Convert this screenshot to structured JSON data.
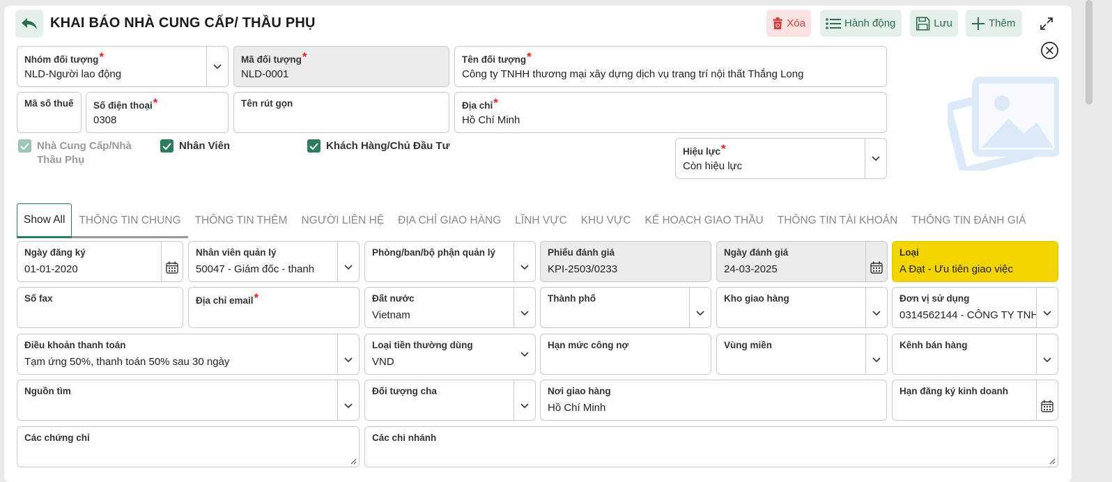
{
  "header": {
    "title": "KHAI BÁO NHÀ CUNG CẤP/ THẦU PHỤ",
    "delete_label": "Xóa",
    "actions_label": "Hành động",
    "save_label": "Lưu",
    "add_label": "Thêm"
  },
  "top": {
    "nhom_doi_tuong": {
      "label": "Nhóm đối tượng",
      "value": "NLD-Người lao động"
    },
    "ma_doi_tuong": {
      "label": "Mã đối tượng",
      "value": "NLD-0001"
    },
    "ten_doi_tuong": {
      "label": "Tên đối tượng",
      "value": "Công ty TNHH thương mại xây dựng dịch vụ trang trí nội thất Thắng Long"
    },
    "ma_so_thue": {
      "label": "Mã số thuế",
      "value": ""
    },
    "so_dien_thoai": {
      "label": "Số điện thoại",
      "value": "0308"
    },
    "ten_rut_gon": {
      "label": "Tên rút gọn",
      "value": ""
    },
    "dia_chi": {
      "label": "Địa chỉ",
      "value": "Hồ Chí Minh"
    },
    "hieu_luc": {
      "label": "Hiệu lực",
      "value": "Còn hiệu lực"
    }
  },
  "checks": {
    "ncc_line1": "Nhà Cung Cấp/Nhà",
    "ncc_line2": "Thầu Phụ",
    "nhan_vien": "Nhân Viên",
    "khach_hang": "Khách Hàng/Chủ Đầu Tư"
  },
  "tabs": [
    "Show All",
    "THÔNG TIN CHUNG",
    "THÔNG TIN THÊM",
    "NGƯỜI LIÊN HỆ",
    "ĐỊA CHỈ GIAO HÀNG",
    "LĨNH VỰC",
    "KHU VỰC",
    "KẾ HOẠCH GIAO THẦU",
    "THÔNG TIN TÀI KHOẢN",
    "THÔNG TIN ĐÁNH GIÁ"
  ],
  "fields": {
    "ngay_dang_ky": {
      "label": "Ngày đăng ký",
      "value": "01-01-2020"
    },
    "nhan_vien_quan_ly": {
      "label": "Nhân viên quản lý",
      "value": "50047 - Giám đốc - thanh"
    },
    "phong_ban": {
      "label": "Phòng/ban/bộ phận quản lý",
      "value": ""
    },
    "phieu_danh_gia": {
      "label": "Phiếu đánh giá",
      "value": "KPI-2503/0233"
    },
    "ngay_danh_gia": {
      "label": "Ngày đánh giá",
      "value": "24-03-2025"
    },
    "loai": {
      "label": "Loại",
      "value": "A Đạt - Ưu tiên giao việc"
    },
    "so_fax": {
      "label": "Số fax",
      "value": ""
    },
    "dia_chi_email": {
      "label": "Địa chỉ email",
      "value": ""
    },
    "dat_nuoc": {
      "label": "Đất nước",
      "value": "Vietnam"
    },
    "thanh_pho": {
      "label": "Thành phố",
      "value": ""
    },
    "kho_giao_hang": {
      "label": "Kho giao hàng",
      "value": ""
    },
    "don_vi_su_dung": {
      "label": "Đơn vị sử dụng",
      "value": "0314562144 - CÔNG TY TNH"
    },
    "dieu_khoan": {
      "label": "Điều khoản thanh toán",
      "value": "Tạm ứng 50%, thanh toán 50% sau 30 ngày"
    },
    "loai_tien": {
      "label": "Loại tiền thường dùng",
      "value": "VND"
    },
    "han_muc": {
      "label": "Hạn mức công nợ",
      "value": ""
    },
    "vung_mien": {
      "label": "Vùng miền",
      "value": ""
    },
    "kenh_ban_hang": {
      "label": "Kênh bán hàng",
      "value": ""
    },
    "nguon_tim": {
      "label": "Nguồn tìm",
      "value": ""
    },
    "doi_tuong_cha": {
      "label": "Đối tượng cha",
      "value": ""
    },
    "noi_giao_hang": {
      "label": "Nơi giao hàng",
      "value": "Hồ Chí Minh"
    },
    "han_dang_ky": {
      "label": "Hạn đăng ký kinh doanh",
      "value": ""
    },
    "cac_chung_chi": {
      "label": "Các chứng chỉ",
      "value": ""
    },
    "cac_chi_nhanh": {
      "label": "Các chi nhánh",
      "value": ""
    }
  },
  "colors": {
    "accent": "#2e7d5a",
    "highlight": "#f2d400",
    "danger": "#d93b3b"
  }
}
